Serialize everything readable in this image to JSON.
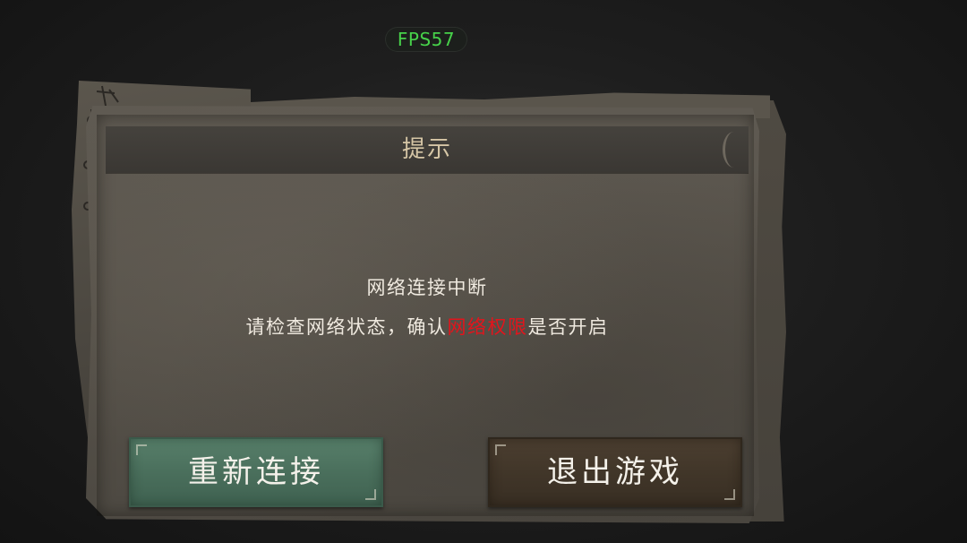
{
  "hud": {
    "fps_label": "FPS57"
  },
  "dialog": {
    "title": "提示",
    "message_line1": "网络连接中断",
    "message_line2_prefix": "请检查网络状态，确认",
    "message_line2_highlight": "网络权限",
    "message_line2_suffix": "是否开启",
    "highlight_color": "#e3141c"
  },
  "buttons": {
    "reconnect_label": "重新连接",
    "exit_label": "退出游戏"
  },
  "colors": {
    "fps_text": "#47d24a",
    "reconnect_button": "#4a6f5c",
    "exit_button": "#413629",
    "title_text": "#d6c6a6"
  }
}
